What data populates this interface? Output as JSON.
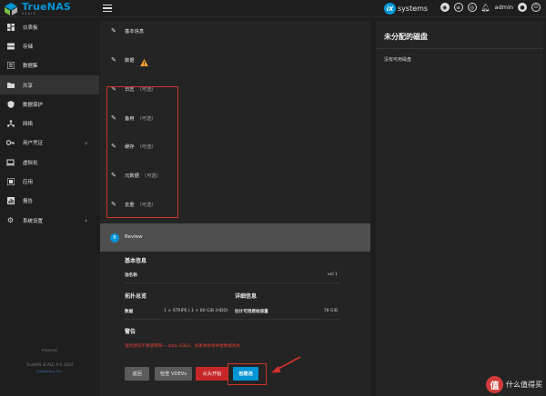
{
  "brand": {
    "name": "TrueNAS",
    "edition": "SCALE"
  },
  "topbar": {
    "ix_logo_letter": "iX",
    "ix_logo_text": "systems",
    "user": "admin",
    "icons": [
      "truecommand-icon",
      "clipboard-icon",
      "jobs-icon",
      "bell-icon",
      "account-icon",
      "power-icon"
    ]
  },
  "sidebar": {
    "items": [
      {
        "label": "仪表板",
        "icon": "dashboard-icon",
        "has_chevron": false
      },
      {
        "label": "存储",
        "icon": "storage-icon",
        "has_chevron": false
      },
      {
        "label": "数据集",
        "icon": "datasets-icon",
        "has_chevron": false
      },
      {
        "label": "共享",
        "icon": "shares-icon",
        "has_chevron": false,
        "active": true
      },
      {
        "label": "数据保护",
        "icon": "shield-icon",
        "has_chevron": false
      },
      {
        "label": "网络",
        "icon": "network-icon",
        "has_chevron": false
      },
      {
        "label": "用户凭证",
        "icon": "key-icon",
        "has_chevron": true
      },
      {
        "label": "虚拟化",
        "icon": "laptop-icon",
        "has_chevron": false
      },
      {
        "label": "应用",
        "icon": "apps-icon",
        "has_chevron": false
      },
      {
        "label": "报告",
        "icon": "reports-icon",
        "has_chevron": false
      },
      {
        "label": "系统设置",
        "icon": "gear-icon",
        "has_chevron": true
      }
    ],
    "footer": {
      "hostname": "truenas",
      "version": "TrueNAS SCALE ®© 2024",
      "company": "iXsystems, Inc."
    }
  },
  "wizard": {
    "steps": [
      {
        "label": "基本信息",
        "optional": ""
      },
      {
        "label": "数据",
        "optional": ""
      },
      {
        "label": "日志",
        "optional": "（可选）"
      },
      {
        "label": "备用",
        "optional": "（可选）"
      },
      {
        "label": "缓存",
        "optional": "（可选）"
      },
      {
        "label": "元数据",
        "optional": "（可选）"
      },
      {
        "label": "去重",
        "optional": "（可选）"
      }
    ],
    "review": {
      "number": "8",
      "label": "Review"
    },
    "basic_info": {
      "title": "基本信息",
      "pool_name_label": "池名称",
      "pool_name_value": "vol 1"
    },
    "topology": {
      "title": "拓扑总览",
      "data_label": "数据",
      "data_value": "1 × STRIPE | 1 × 80 GiB (HDD)"
    },
    "details": {
      "title": "详细信息",
      "capacity_label": "估计可用原始容量",
      "capacity_value": "78 GiB"
    },
    "warnings": {
      "title": "警告",
      "text": "强烈建议不要使用单一 data VDEV，如果失败将导致数据丢失"
    },
    "buttons": {
      "back": "返回",
      "inspect": "检查 VDEVs",
      "reset": "从头开始",
      "create": "创建池"
    }
  },
  "unassigned": {
    "title": "未分配的磁盘",
    "empty": "没有可用磁盘"
  },
  "watermark": {
    "letter": "值",
    "text": "什么值得买"
  },
  "colors": {
    "accent": "#0095d5",
    "danger": "#c62828",
    "highlight": "#d0322d",
    "warning": "#f0a030"
  }
}
